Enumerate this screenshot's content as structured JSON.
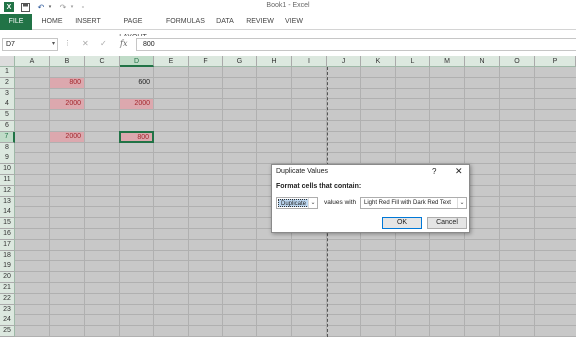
{
  "window": {
    "title": "Book1 - Excel"
  },
  "quick_access": {
    "icons": [
      "excel-logo-icon",
      "save-icon",
      "undo-icon",
      "redo-icon",
      "customize-icon"
    ]
  },
  "ribbon": {
    "tabs": [
      "FILE",
      "HOME",
      "INSERT",
      "PAGE LAYOUT",
      "FORMULAS",
      "DATA",
      "REVIEW",
      "VIEW"
    ]
  },
  "formula_bar": {
    "name_box": "D7",
    "value": "800",
    "fx_label": "fx"
  },
  "sheet": {
    "columns": [
      "A",
      "B",
      "C",
      "D",
      "E",
      "F",
      "G",
      "H",
      "I",
      "J",
      "K",
      "L",
      "M",
      "N",
      "O",
      "P"
    ],
    "rows": [
      "1",
      "2",
      "3",
      "4",
      "5",
      "6",
      "7",
      "8",
      "9",
      "10",
      "11",
      "12",
      "13",
      "14",
      "15",
      "16",
      "17",
      "18",
      "19",
      "20",
      "21",
      "22",
      "23",
      "24",
      "25",
      "26"
    ],
    "active_cell": "D7",
    "cells": [
      {
        "ref": "B2",
        "value": "800",
        "duplicate": true
      },
      {
        "ref": "D2",
        "value": "600",
        "duplicate": false
      },
      {
        "ref": "B4",
        "value": "2000",
        "duplicate": true
      },
      {
        "ref": "D4",
        "value": "2000",
        "duplicate": true
      },
      {
        "ref": "B7",
        "value": "2000",
        "duplicate": true
      },
      {
        "ref": "D7",
        "value": "800",
        "duplicate": true
      }
    ],
    "highlight_color": "#dca8ae",
    "highlight_text_color": "#a4262c"
  },
  "dialog": {
    "title": "Duplicate Values",
    "help": "?",
    "close": "✕",
    "label": "Format cells that contain:",
    "type_value": "Duplicate",
    "middle_text": "values with",
    "format_value": "Light Red Fill with Dark Red Text",
    "ok_label": "OK",
    "cancel_label": "Cancel"
  },
  "colors": {
    "accent": "#217346"
  }
}
